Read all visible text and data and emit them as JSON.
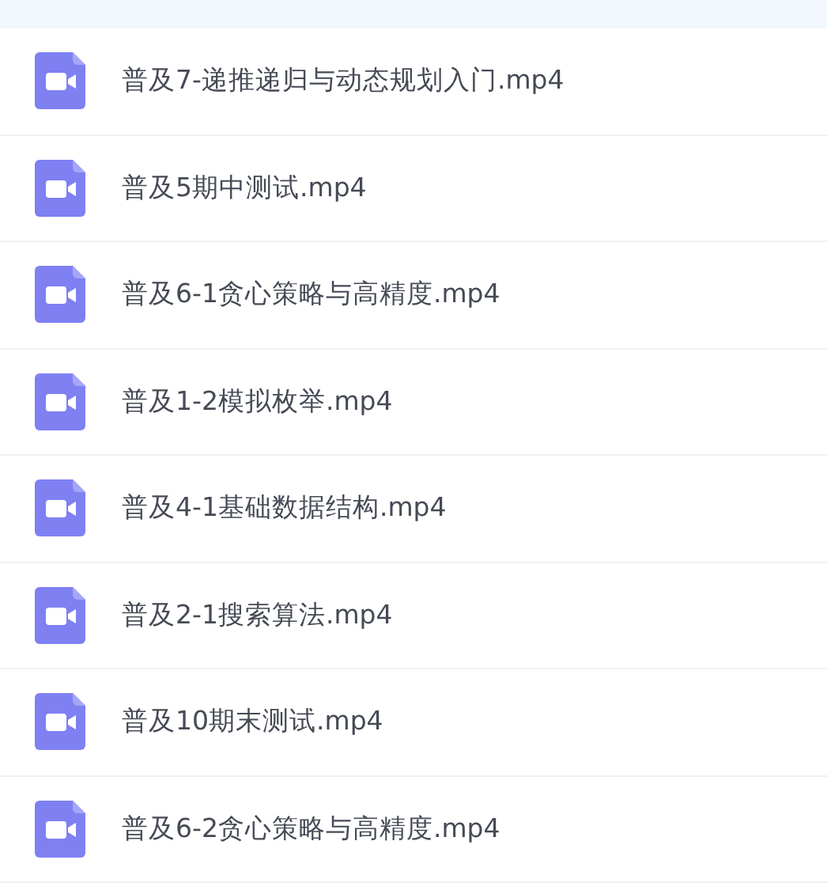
{
  "files": [
    {
      "name": "普及7-递推递归与动态规划入门.mp4"
    },
    {
      "name": "普及5期中测试.mp4"
    },
    {
      "name": "普及6-1贪心策略与高精度.mp4"
    },
    {
      "name": "普及1-2模拟枚举.mp4"
    },
    {
      "name": "普及4-1基础数据结构.mp4"
    },
    {
      "name": "普及2-1搜索算法.mp4"
    },
    {
      "name": "普及10期末测试.mp4"
    },
    {
      "name": "普及6-2贪心策略与高精度.mp4"
    }
  ]
}
